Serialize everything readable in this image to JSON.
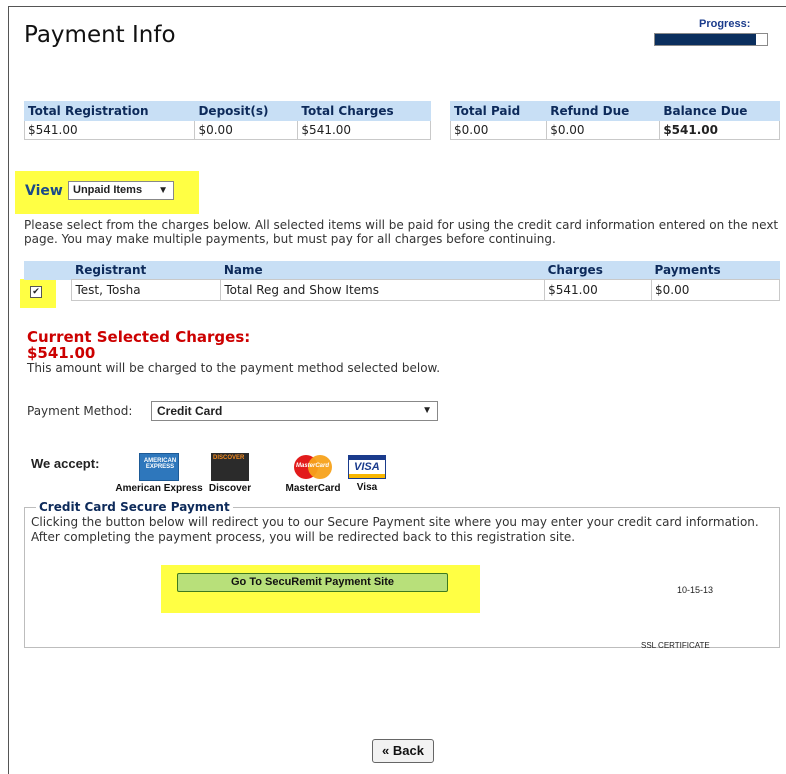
{
  "header": {
    "title": "Payment Info",
    "progress_label": "Progress:",
    "progress_fraction": 0.9
  },
  "summary": {
    "left": {
      "headers": [
        "Total Registration",
        "Deposit(s)",
        "Total Charges"
      ],
      "values": [
        "$541.00",
        "$0.00",
        "$541.00"
      ]
    },
    "right": {
      "headers": [
        "Total Paid",
        "Refund Due",
        "Balance Due"
      ],
      "values": [
        "$0.00",
        "$0.00",
        "$541.00"
      ]
    }
  },
  "view": {
    "label": "View",
    "selected": "Unpaid Items"
  },
  "instructions": "Please select from the charges below. All selected items will be paid for using the credit card information entered on the next page. You may make multiple payments, but must pay for all charges before continuing.",
  "charges_table": {
    "headers": [
      "",
      "Registrant",
      "Name",
      "Charges",
      "Payments"
    ],
    "rows": [
      {
        "checked": true,
        "checkmark": "✔",
        "registrant": "Test, Tosha",
        "name": "Total Reg and Show Items",
        "charges": "$541.00",
        "payments": "$0.00"
      }
    ]
  },
  "current": {
    "label": "Current Selected Charges:",
    "amount": "$541.00",
    "note": "This amount will be charged to the payment method selected below."
  },
  "payment_method": {
    "label": "Payment Method:",
    "selected": "Credit Card"
  },
  "accept": {
    "label": "We accept:",
    "cards": [
      {
        "name": "American Express",
        "logo_text": "AMERICAN EXPRESS",
        "icon": "amex-icon"
      },
      {
        "name": "Discover",
        "logo_text": "DISCOVER",
        "icon": "discover-icon"
      },
      {
        "name": "MasterCard",
        "logo_text": "MasterCard",
        "icon": "mastercard-icon"
      },
      {
        "name": "Visa",
        "logo_text": "VISA",
        "icon": "visa-icon"
      }
    ]
  },
  "secure": {
    "legend": "Credit Card Secure Payment",
    "text": "Clicking the button below will redirect you to our Secure Payment site where you may enter your credit card information. After completing the payment process, you will be redirected back to this registration site.",
    "button_label": "Go To SecuRemit Payment Site",
    "ssl_date": "10-15-13",
    "ssl_label": "SSL CERTIFICATE"
  },
  "footer": {
    "back_label": "« Back"
  },
  "colors": {
    "header_bg": "#c8dff5",
    "header_text": "#0d2a5a",
    "highlight": "#ffff44",
    "alert_red": "#cc0000",
    "progress_fill": "#0b2f5e",
    "button_green": "#b8e07a"
  },
  "icons": {
    "dropdown_caret": "▼"
  }
}
